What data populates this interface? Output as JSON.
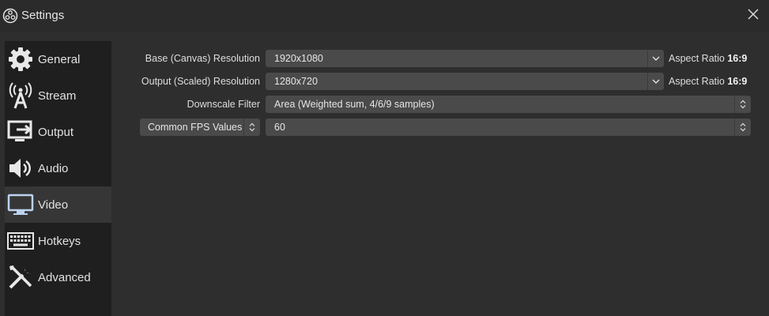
{
  "window": {
    "title": "Settings"
  },
  "sidebar": {
    "items": [
      {
        "label": "General",
        "icon": "gear-icon",
        "active": false
      },
      {
        "label": "Stream",
        "icon": "antenna-icon",
        "active": false
      },
      {
        "label": "Output",
        "icon": "output-icon",
        "active": false
      },
      {
        "label": "Audio",
        "icon": "speaker-icon",
        "active": false
      },
      {
        "label": "Video",
        "icon": "monitor-icon",
        "active": true
      },
      {
        "label": "Hotkeys",
        "icon": "keyboard-icon",
        "active": false
      },
      {
        "label": "Advanced",
        "icon": "tools-icon",
        "active": false
      }
    ]
  },
  "video": {
    "base_resolution": {
      "label": "Base (Canvas) Resolution",
      "value": "1920x1080",
      "aspect_label": "Aspect Ratio",
      "aspect_value": "16:9"
    },
    "output_resolution": {
      "label": "Output (Scaled) Resolution",
      "value": "1280x720",
      "aspect_label": "Aspect Ratio",
      "aspect_value": "16:9"
    },
    "downscale_filter": {
      "label": "Downscale Filter",
      "value": "Area (Weighted sum, 4/6/9 samples)"
    },
    "fps": {
      "type_value": "Common FPS Values",
      "value": "60"
    }
  },
  "colors": {
    "background": "#2e2e2e",
    "sidebar": "#1f1f1f",
    "sidebar_active": "#363636",
    "field": "#4a4a4a",
    "text": "#dedede"
  }
}
